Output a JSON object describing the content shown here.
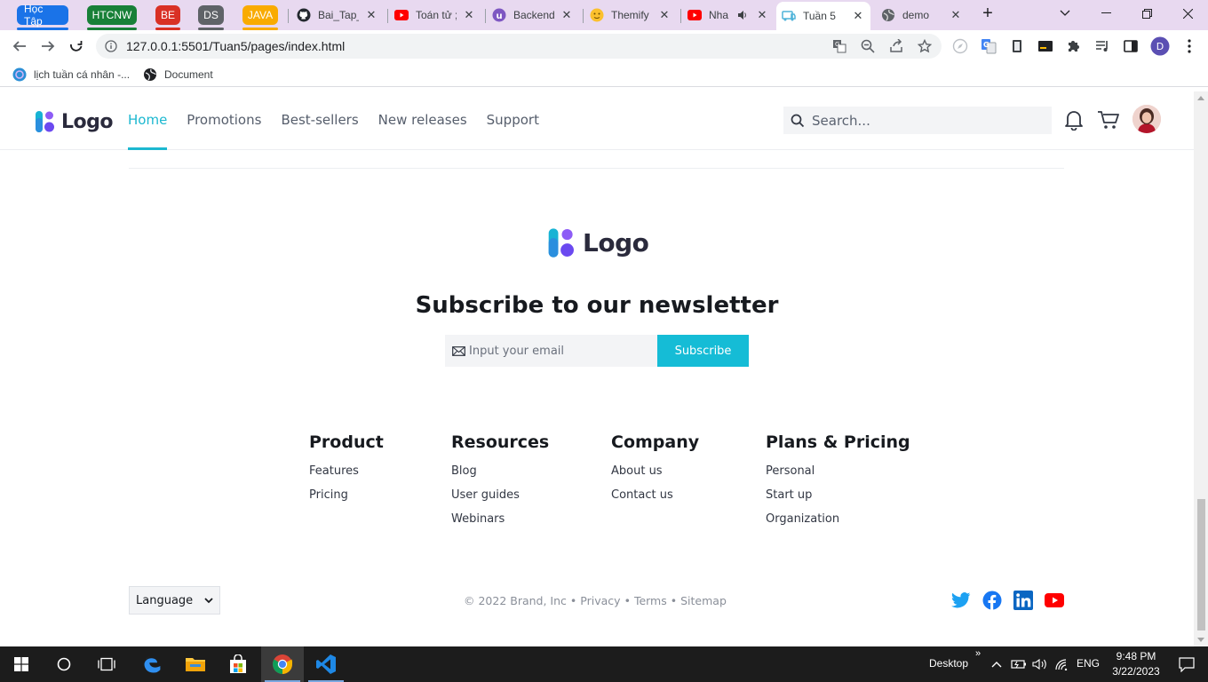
{
  "browser": {
    "tab_groups": [
      {
        "label": "Học Tập",
        "color": "#1a73e8"
      },
      {
        "label": "HTCNW",
        "color": "#188038"
      },
      {
        "label": "BE",
        "color": "#d93025"
      },
      {
        "label": "DS",
        "color": "#5f6368"
      },
      {
        "label": "JAVA",
        "color": "#f9ab00"
      }
    ],
    "tabs": [
      {
        "title": "Bai_Tap_",
        "icon": "github-icon"
      },
      {
        "title": "Toán tử ;",
        "icon": "youtube-icon"
      },
      {
        "title": "Backend",
        "icon": "extension-icon"
      },
      {
        "title": "Themify",
        "icon": "emoji-icon"
      },
      {
        "title": "Nha",
        "icon": "youtube-icon"
      },
      {
        "title": "Tuần 5",
        "icon": "live-server-icon"
      },
      {
        "title": "demo",
        "icon": "globe-icon"
      }
    ],
    "url": "127.0.0.1:5501/Tuan5/pages/index.html",
    "bookmarks": [
      {
        "label": "lịch tuần cá nhân -...",
        "icon": "canva-icon"
      },
      {
        "label": "Document",
        "icon": "globe-icon"
      }
    ],
    "profile_initial": "D"
  },
  "site": {
    "logo_text": "Logo",
    "nav": [
      {
        "label": "Home",
        "active": true
      },
      {
        "label": "Promotions",
        "active": false
      },
      {
        "label": "Best-sellers",
        "active": false
      },
      {
        "label": "New releases",
        "active": false
      },
      {
        "label": "Support",
        "active": false
      }
    ],
    "search_placeholder": "Search...",
    "accent_color": "#1cb8d0"
  },
  "footer": {
    "logo_text": "Logo",
    "newsletter_title": "Subscribe to our newsletter",
    "email_placeholder": "Input your email",
    "subscribe_label": "Subscribe",
    "columns": [
      {
        "title": "Product",
        "links": [
          "Features",
          "Pricing"
        ]
      },
      {
        "title": "Resources",
        "links": [
          "Blog",
          "User guides",
          "Webinars"
        ]
      },
      {
        "title": "Company",
        "links": [
          "About us",
          "Contact us"
        ]
      },
      {
        "title": "Plans & Pricing",
        "links": [
          "Personal",
          "Start up",
          "Organization"
        ]
      }
    ],
    "language_label": "Language",
    "copyright": "© 2022 Brand, Inc",
    "legal_links": [
      "Privacy",
      "Terms",
      "Sitemap"
    ],
    "social": [
      "twitter-icon",
      "facebook-icon",
      "linkedin-icon",
      "youtube-icon"
    ]
  },
  "taskbar": {
    "desktop_label": "Desktop",
    "language": "ENG",
    "time": "9:48 PM",
    "date": "3/22/2023"
  }
}
